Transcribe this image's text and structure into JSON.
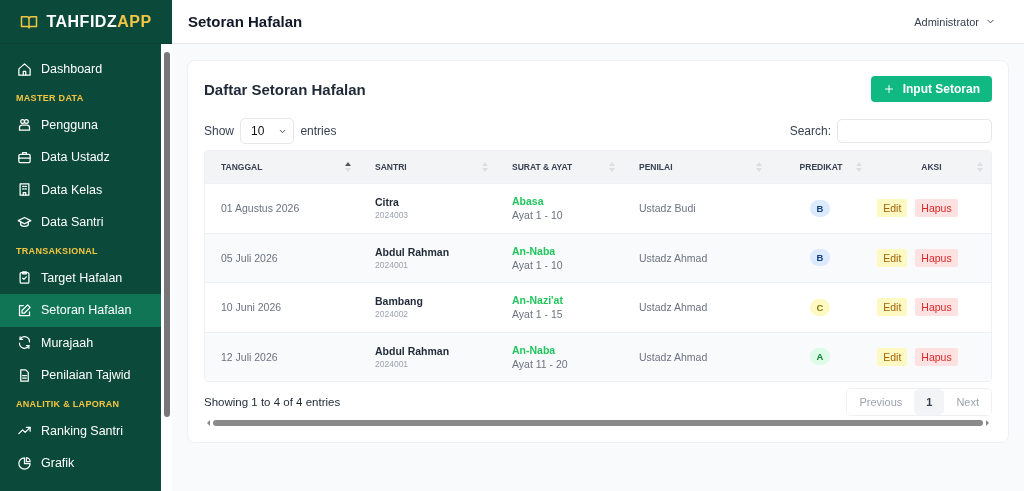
{
  "brand": {
    "name_main": "TAHFIDZ",
    "name_accent": "APP"
  },
  "sidebar": {
    "items": [
      {
        "kind": "link",
        "label": "Dashboard",
        "selected": false
      },
      {
        "kind": "section",
        "label": "MASTER DATA"
      },
      {
        "kind": "link",
        "label": "Pengguna",
        "selected": false
      },
      {
        "kind": "link",
        "label": "Data Ustadz",
        "selected": false
      },
      {
        "kind": "link",
        "label": "Data Kelas",
        "selected": false
      },
      {
        "kind": "link",
        "label": "Data Santri",
        "selected": false
      },
      {
        "kind": "section",
        "label": "TRANSAKSIONAL"
      },
      {
        "kind": "link",
        "label": "Target Hafalan",
        "selected": false
      },
      {
        "kind": "link",
        "label": "Setoran Hafalan",
        "selected": true
      },
      {
        "kind": "link",
        "label": "Murajaah",
        "selected": false
      },
      {
        "kind": "link",
        "label": "Penilaian Tajwid",
        "selected": false
      },
      {
        "kind": "section",
        "label": "ANALITIK & LAPORAN"
      },
      {
        "kind": "link",
        "label": "Ranking Santri",
        "selected": false
      },
      {
        "kind": "link",
        "label": "Grafik",
        "selected": false
      }
    ]
  },
  "topbar": {
    "title": "Setoran Hafalan",
    "user": "Administrator"
  },
  "card": {
    "title": "Daftar Setoran Hafalan",
    "add_button": "Input Setoran",
    "length": {
      "before": "Show",
      "value": "10",
      "after": "entries"
    },
    "search": {
      "label": "Search:"
    },
    "table": {
      "columns": [
        {
          "label": "TANGGAL",
          "sorted": true
        },
        {
          "label": "SANTRI",
          "sorted": false
        },
        {
          "label": "SURAT & AYAT",
          "sorted": false
        },
        {
          "label": "PENILAI",
          "sorted": false
        },
        {
          "label": "PREDIKAT",
          "sorted": false
        },
        {
          "label": "AKSI",
          "sorted": false
        }
      ],
      "rows": [
        {
          "tanggal": "01 Agustus 2026",
          "santri": "Citra",
          "nis": "2024003",
          "surat": "Abasa",
          "ayat": "Ayat 1 - 10",
          "penilai": "Ustadz Budi",
          "predikat": "B",
          "color": "#dbeafe",
          "actions": [
            "Edit",
            "Hapus"
          ]
        },
        {
          "tanggal": "05 Juli 2026",
          "santri": "Abdul Rahman",
          "nis": "2024001",
          "surat": "An-Naba",
          "ayat": "Ayat 1 - 10",
          "penilai": "Ustadz Ahmad",
          "predikat": "B",
          "color": "#dbeafe",
          "actions": [
            "Edit",
            "Hapus"
          ]
        },
        {
          "tanggal": "10 Juni 2026",
          "santri": "Bambang",
          "nis": "2024002",
          "surat": "An-Nazi'at",
          "ayat": "Ayat 1 - 15",
          "penilai": "Ustadz Ahmad",
          "predikat": "C",
          "color": "#fef9c3",
          "actions": [
            "Edit",
            "Hapus"
          ]
        },
        {
          "tanggal": "12 Juli 2026",
          "santri": "Abdul Rahman",
          "nis": "2024001",
          "surat": "An-Naba",
          "ayat": "Ayat 11 - 20",
          "penilai": "Ustadz Ahmad",
          "predikat": "A",
          "color": "#dcfce7",
          "actions": [
            "Edit",
            "Hapus"
          ]
        }
      ]
    },
    "info": "Showing 1 to 4 of 4 entries",
    "pagination": [
      {
        "label": "Previous",
        "selected": false,
        "disabled": true
      },
      {
        "label": "1",
        "selected": true,
        "disabled": false
      },
      {
        "label": "Next",
        "selected": false,
        "disabled": true
      }
    ]
  }
}
